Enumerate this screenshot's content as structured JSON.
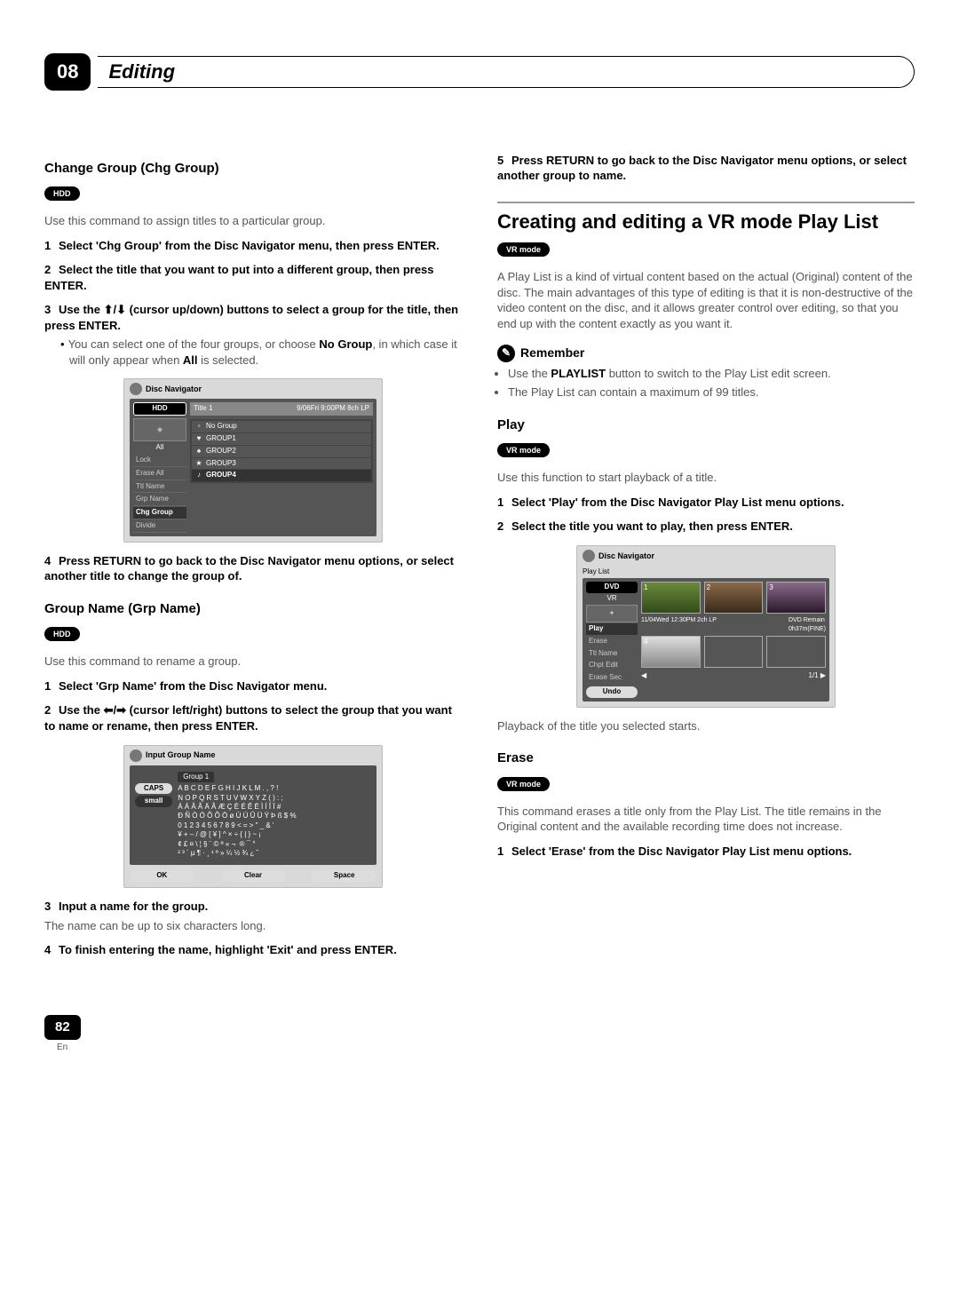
{
  "chapter": {
    "num": "08",
    "title": "Editing"
  },
  "left": {
    "chg_group": {
      "heading": "Change Group (Chg Group)",
      "badge": "HDD",
      "intro": "Use this command to assign titles to a particular group.",
      "step1": "Select 'Chg Group' from the Disc Navigator menu, then press ENTER.",
      "step2": "Select the title that you want to put into a different group, then press ENTER.",
      "step3_a": "Use the ",
      "step3_b": " (cursor up/down) buttons to select a group for the title, then press ENTER.",
      "bullet_a": "You can select one of the four groups, or choose ",
      "bullet_b": ", in which case it will only appear when ",
      "bullet_c": " is selected.",
      "bullet_no_group": "No Group",
      "bullet_all": "All",
      "step4": "Press RETURN to go back to the Disc Navigator menu options, or select another title to change the group of."
    },
    "shot1": {
      "title": "Disc Navigator",
      "hdd": "HDD",
      "all": "All",
      "menu": [
        "Lock",
        "Erase All",
        "Ttl Name",
        "Grp Name",
        "Chg Group",
        "Divide"
      ],
      "sel_idx": 4,
      "title1": "Title 1",
      "meta": "9/06Fri  9:00PM   8ch  LP",
      "groups": [
        "No Group",
        "GROUP1",
        "GROUP2",
        "GROUP3",
        "GROUP4"
      ],
      "group_sel": 4
    },
    "grp_name": {
      "heading": "Group Name (Grp Name)",
      "badge": "HDD",
      "intro": "Use this command to rename a group.",
      "step1": "Select 'Grp Name' from the Disc Navigator menu.",
      "step2_a": "Use the ",
      "step2_b": " (cursor left/right) buttons to select the group that you want to name or rename, then press ENTER.",
      "step3": "Input a name for the group.",
      "step3_note": "The name can be up to six characters long.",
      "step4": "To finish entering the name, highlight 'Exit' and press ENTER."
    },
    "shot2": {
      "title": "Input Group Name",
      "caps": "CAPS",
      "small": "small",
      "field": "Group 1",
      "line1": "A B C D E F G H I J K L M . , ? !",
      "line2": "N O P Q R S T U V W X Y Z ( ) : ;",
      "line3": "À Á Â Ã Ä Å Æ Ç È É Ê Ë Ì Í Î Ï #",
      "line4": "Ð Ñ Ò Ó Ô Õ Ö ø Ù Ú Û Ü Ý Þ ß $ %",
      "line5": "0 1 2 3 4 5 6 7 8 9 < = > \" _ & '",
      "line6": "¥ + – / @ [ ¥ ] ^ × ÷ { | } ~ ¡",
      "line7": "¢ £ ¤ \\ ¦ § ¨ © ª « ¬ ­ ® ¯ °",
      "line8": "² ³ ´ µ ¶ · ¸ ¹ º » ¼ ½ ¾ ¿ ˘",
      "ok": "OK",
      "clear": "Clear",
      "space": "Space"
    }
  },
  "right": {
    "step5": "Press RETURN to go back to the Disc Navigator menu options, or select another group to name.",
    "vr_main": "Creating and editing a VR mode Play List",
    "vr_badge": "VR mode",
    "vr_intro": "A Play List is a kind of virtual content based on the actual (Original) content of the disc. The main advantages of this type of editing is that it is non-destructive of the video content on the disc, and it allows greater control over editing, so that you end up with the content exactly as you want it.",
    "remember": "Remember",
    "rem1_a": "Use the ",
    "rem1_b": " button to switch to the Play List edit screen.",
    "rem1_bold": "PLAYLIST",
    "rem2": "The Play List can contain a maximum of 99 titles.",
    "play_h": "Play",
    "play_badge": "VR mode",
    "play_intro": "Use this function to start playback of a title.",
    "play_step1": "Select 'Play' from the Disc Navigator Play List menu options.",
    "play_step2": "Select the title you want to play, then press ENTER.",
    "play_after": "Playback of the title you selected starts.",
    "erase_h": "Erase",
    "erase_badge": "VR mode",
    "erase_intro": "This command erases a title only from the Play List. The title remains in the Original content and the available recording time does not increase.",
    "erase_step1": "Select 'Erase' from the Disc Navigator Play List menu options.",
    "shot3": {
      "title": "Disc Navigator",
      "sub": "Play List",
      "dvd": "DVD",
      "vr": "VR",
      "menu": [
        "Play",
        "Erase",
        "Ttl Name",
        "Chpt Edit",
        "Erase Sec"
      ],
      "sel_idx": 0,
      "undo": "Undo",
      "meta": "11/04Wed 12:30PM   2ch  LP",
      "remain_lbl": "DVD Remain",
      "remain_val": "0h37m(FINE)",
      "pager": "1/1"
    }
  },
  "footer": {
    "page": "82",
    "lang": "En"
  }
}
